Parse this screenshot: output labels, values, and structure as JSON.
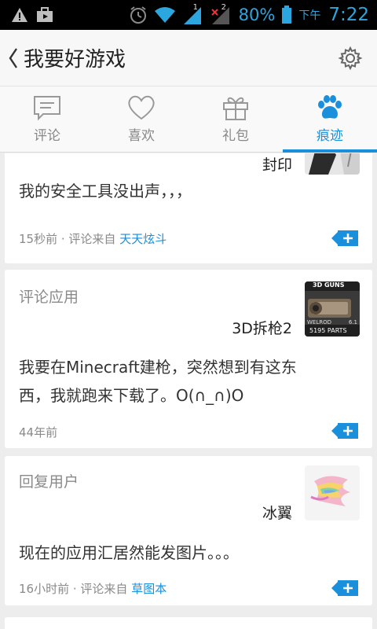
{
  "status": {
    "battery_percent": "80%",
    "ampm": "下午",
    "time": "7:22",
    "sim1": "1",
    "sim2": "2"
  },
  "header": {
    "title": "我要好游戏"
  },
  "tabs": [
    {
      "label": "评论",
      "icon": "comment-icon",
      "active": false
    },
    {
      "label": "喜欢",
      "icon": "heart-icon",
      "active": false
    },
    {
      "label": "礼包",
      "icon": "gift-icon",
      "active": false
    },
    {
      "label": "痕迹",
      "icon": "paw-icon",
      "active": true
    }
  ],
  "accent_color": "#1a8fdc",
  "cards": [
    {
      "app_name": "封印",
      "text": "我的安全工具没出声，，，",
      "time": "15秒前",
      "via_prefix": "· 评论来自",
      "source": "天天炫斗"
    },
    {
      "type": "评论应用",
      "app_name": "3D拆枪2",
      "thumb_text_top": "3D GUNS",
      "thumb_text_bottom": "5195 PARTS",
      "thumb_text_left": "WELROD",
      "thumb_text_right": "6.1",
      "text_line1": "我要在Minecraft建枪，突然想到有这东",
      "text_line2": "西，我就跑来下载了。O(∩_∩)O",
      "time": "44年前"
    },
    {
      "type": "回复用户",
      "app_name": "冰翼",
      "text": "现在的应用汇居然能发图片。。。",
      "time": "16小时前",
      "via_prefix": "· 评论来自",
      "source": "草图本"
    }
  ]
}
